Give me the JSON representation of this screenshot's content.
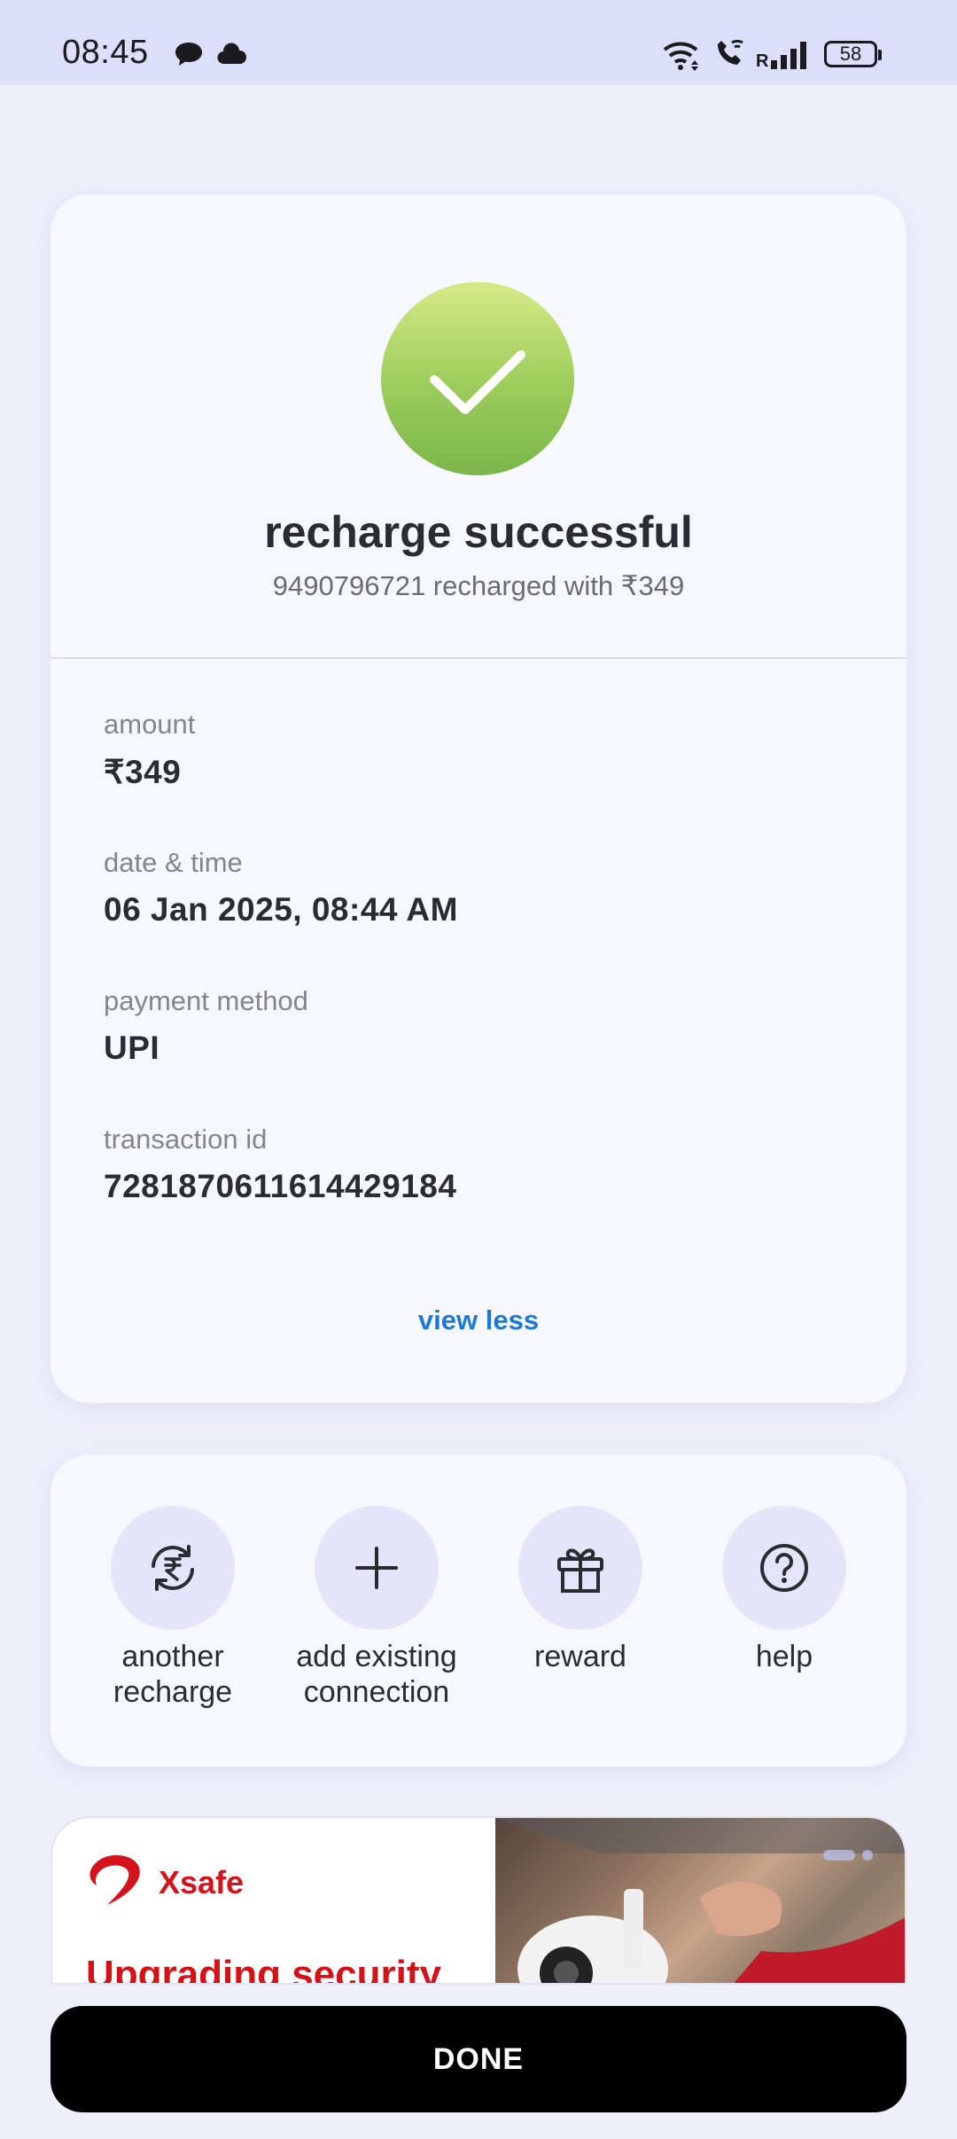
{
  "status_bar": {
    "time": "08:45",
    "battery": "58",
    "network_label": "R",
    "icons": [
      "chat-bubble-icon",
      "cloud-icon",
      "wifi-icon",
      "wifi-call-icon",
      "signal-icon",
      "battery-icon"
    ]
  },
  "success": {
    "title": "recharge successful",
    "subtitle": "9490796721 recharged with ₹349",
    "accent_color": "#8cc353"
  },
  "details": [
    {
      "label": "amount",
      "value": "₹349"
    },
    {
      "label": "date & time",
      "value": "06 Jan 2025, 08:44 AM"
    },
    {
      "label": "payment method",
      "value": "UPI"
    },
    {
      "label": "transaction id",
      "value": "7281870611614429184"
    }
  ],
  "view_less": "view less",
  "actions": [
    {
      "label": "another recharge",
      "icon": "rupee-refresh-icon"
    },
    {
      "label": "add existing connection",
      "icon": "plus-icon"
    },
    {
      "label": "reward",
      "icon": "gift-icon"
    },
    {
      "label": "help",
      "icon": "help-icon"
    }
  ],
  "banner": {
    "brand": "Xsafe",
    "headline": "Upgrading security",
    "brand_color": "#d4121a"
  },
  "done_label": "DONE"
}
